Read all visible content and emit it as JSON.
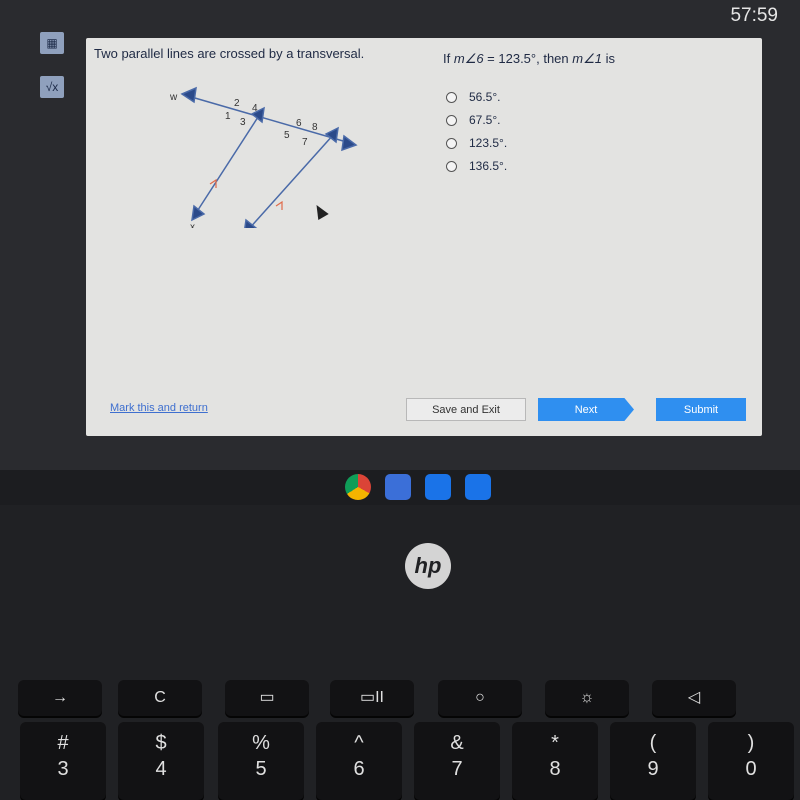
{
  "timer": "57:59",
  "sidebar": {
    "tools": [
      {
        "icon": "calculator-icon",
        "label": "▦"
      },
      {
        "icon": "square-root-icon",
        "label": "√x"
      }
    ]
  },
  "question": {
    "prompt": "Two parallel lines are crossed by a transversal.",
    "stem_prefix": "If ",
    "stem_m6": "m∠6",
    "stem_mid": " = 123.5°, then ",
    "stem_m1": "m∠1",
    "stem_suffix": " is",
    "diagram": {
      "line_labels": [
        "w",
        "x",
        "y"
      ],
      "angle_labels": [
        "1",
        "2",
        "3",
        "4",
        "5",
        "6",
        "7",
        "8"
      ],
      "line_color": "#4a6aa8",
      "parallel_mark_color": "#e06b4a"
    },
    "options": [
      "56.5°.",
      "67.5°.",
      "123.5°.",
      "136.5°."
    ]
  },
  "footer": {
    "mark_link": "Mark this and return",
    "save_exit": "Save and Exit",
    "next": "Next",
    "submit": "Submit",
    "accent": "#2f8ff0"
  },
  "shelf": [
    {
      "icon": "chrome-icon"
    },
    {
      "icon": "x-app-icon"
    },
    {
      "icon": "camera-icon"
    },
    {
      "icon": "video-icon"
    }
  ],
  "laptop": {
    "logo": "hp"
  },
  "keyboard": {
    "function_row": [
      "→",
      "C",
      "▭",
      "▭II",
      "○",
      "☼",
      "◁"
    ],
    "number_row": [
      {
        "top": "#",
        "bottom": "3"
      },
      {
        "top": "$",
        "bottom": "4"
      },
      {
        "top": "%",
        "bottom": "5"
      },
      {
        "top": "^",
        "bottom": "6"
      },
      {
        "top": "&",
        "bottom": "7"
      },
      {
        "top": "*",
        "bottom": "8"
      },
      {
        "top": "(",
        "bottom": "9"
      },
      {
        "top": ")",
        "bottom": "0"
      }
    ]
  }
}
